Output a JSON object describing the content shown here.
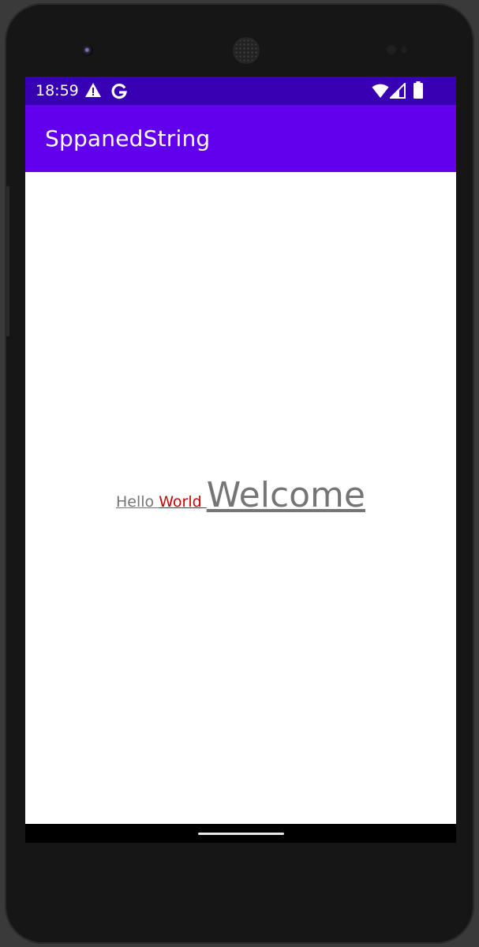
{
  "status_bar": {
    "time": "18:59",
    "icons": [
      "warning-icon",
      "google-icon",
      "wifi-icon",
      "cell-signal-icon",
      "battery-icon"
    ],
    "color": "#3700b3"
  },
  "app_bar": {
    "title": "SppanedString",
    "color": "#6200ee"
  },
  "content": {
    "spanned_text": {
      "hello": "Hello ",
      "world": "World ",
      "welcome": "Welcome"
    },
    "colors": {
      "default_text": "#757575",
      "highlight": "#cc0000"
    }
  }
}
